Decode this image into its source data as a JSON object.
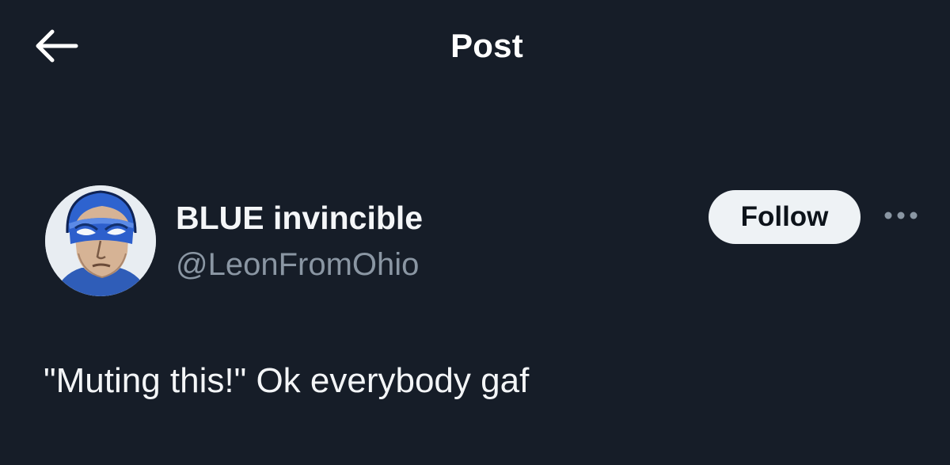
{
  "header": {
    "title": "Post",
    "back_icon": "arrow-left-icon"
  },
  "post": {
    "author": {
      "display_name": "BLUE invincible",
      "handle": "@LeonFromOhio",
      "avatar_icon": "masked-hero-avatar"
    },
    "follow_label": "Follow",
    "more_icon": "more-horizontal-icon",
    "text": "\"Muting this!\" Ok everybody gaf"
  },
  "colors": {
    "background": "#161d28",
    "text_primary": "#f3f5f7",
    "text_secondary": "#8a96a3",
    "follow_bg": "#eef2f5",
    "follow_text": "#0d131a"
  }
}
